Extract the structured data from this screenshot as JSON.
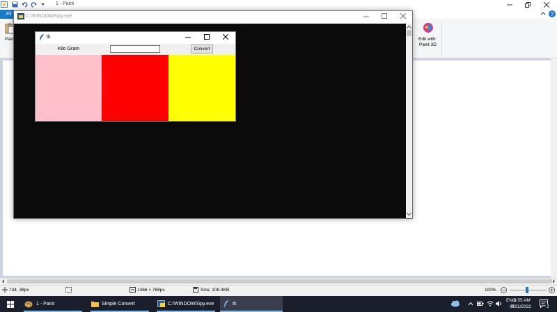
{
  "paint": {
    "window_title": "1 - Paint",
    "file_tab": "Fil",
    "paste_label": "Paste",
    "edit_with_label": "Edit with",
    "paint3d_label": "Paint 3D",
    "status": {
      "cursor_pos": "734, 38px",
      "image_size": "1366 × 768px",
      "file_size": "Size: 108.3KB",
      "zoom": "100%"
    }
  },
  "console": {
    "title": "C:\\WINDOWS\\py.exe"
  },
  "tk_window": {
    "title": "tk",
    "label": "Kilo Gram",
    "entry_value": "",
    "convert_button": "Convert",
    "boxes": [
      {
        "name": "pink",
        "color": "#ffc0cb"
      },
      {
        "name": "red",
        "color": "#ff0000"
      },
      {
        "name": "yellow",
        "color": "#ffff00"
      }
    ]
  },
  "taskbar": {
    "items": [
      {
        "label": "1 - Paint",
        "icon": "paint-icon",
        "active": false
      },
      {
        "label": "Simple Convert",
        "icon": "folder-icon",
        "active": false
      },
      {
        "label": "C:\\WINDOWS\\py.exe",
        "icon": "python-console-icon",
        "active": false
      },
      {
        "label": "tk",
        "icon": "tk-feather-icon",
        "active": true
      }
    ],
    "tray": {
      "lang_top": "ENG",
      "lang_bottom": "IN",
      "time": "8:55 AM",
      "date": "7/31/2022",
      "notification_count": "2"
    }
  },
  "colors": {
    "accent": "#1979ca",
    "taskbar": "#1b1f2b",
    "console_bg": "#0c0c0c"
  }
}
